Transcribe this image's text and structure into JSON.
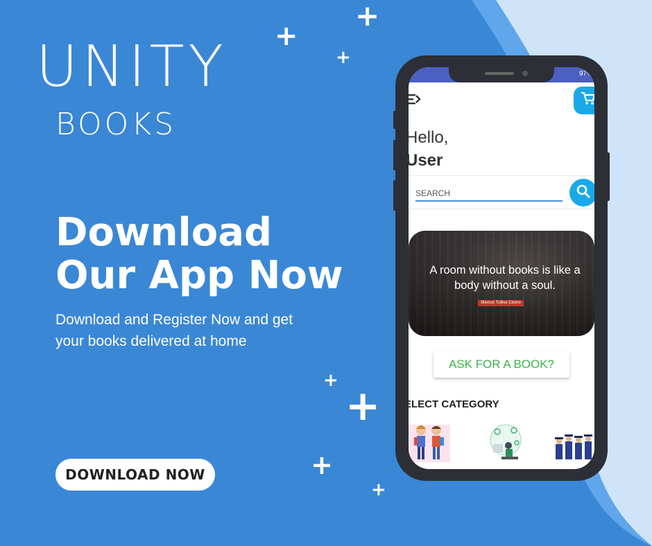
{
  "brand": {
    "line1": "UNITY",
    "line2": "BOOKS"
  },
  "hero": {
    "headline": "Download Our App Now",
    "subline": "Download and Register Now and get your books delivered at home",
    "button_label": "DOWNLOAD NOW"
  },
  "colors": {
    "background": "#3a87d6",
    "accent": "#1aa9e8",
    "light_curve": "#cfe4f8",
    "phone_body": "#2c2f36"
  },
  "phone": {
    "status": "97%",
    "greeting": "Hello,",
    "user_name": "User",
    "search_placeholder": "SEARCH",
    "banner_quote": "A room without books is like a body without a soul.",
    "banner_attribution": "Marcus Tullius Cicero",
    "ask_button_label": "ASK FOR A BOOK?",
    "category_title": "ELECT CATEGORY",
    "categories": [
      "kids-category",
      "tech-category",
      "graduation-category"
    ]
  },
  "icons": [
    "plus-icon",
    "menu-icon",
    "cart-icon",
    "search-icon"
  ]
}
